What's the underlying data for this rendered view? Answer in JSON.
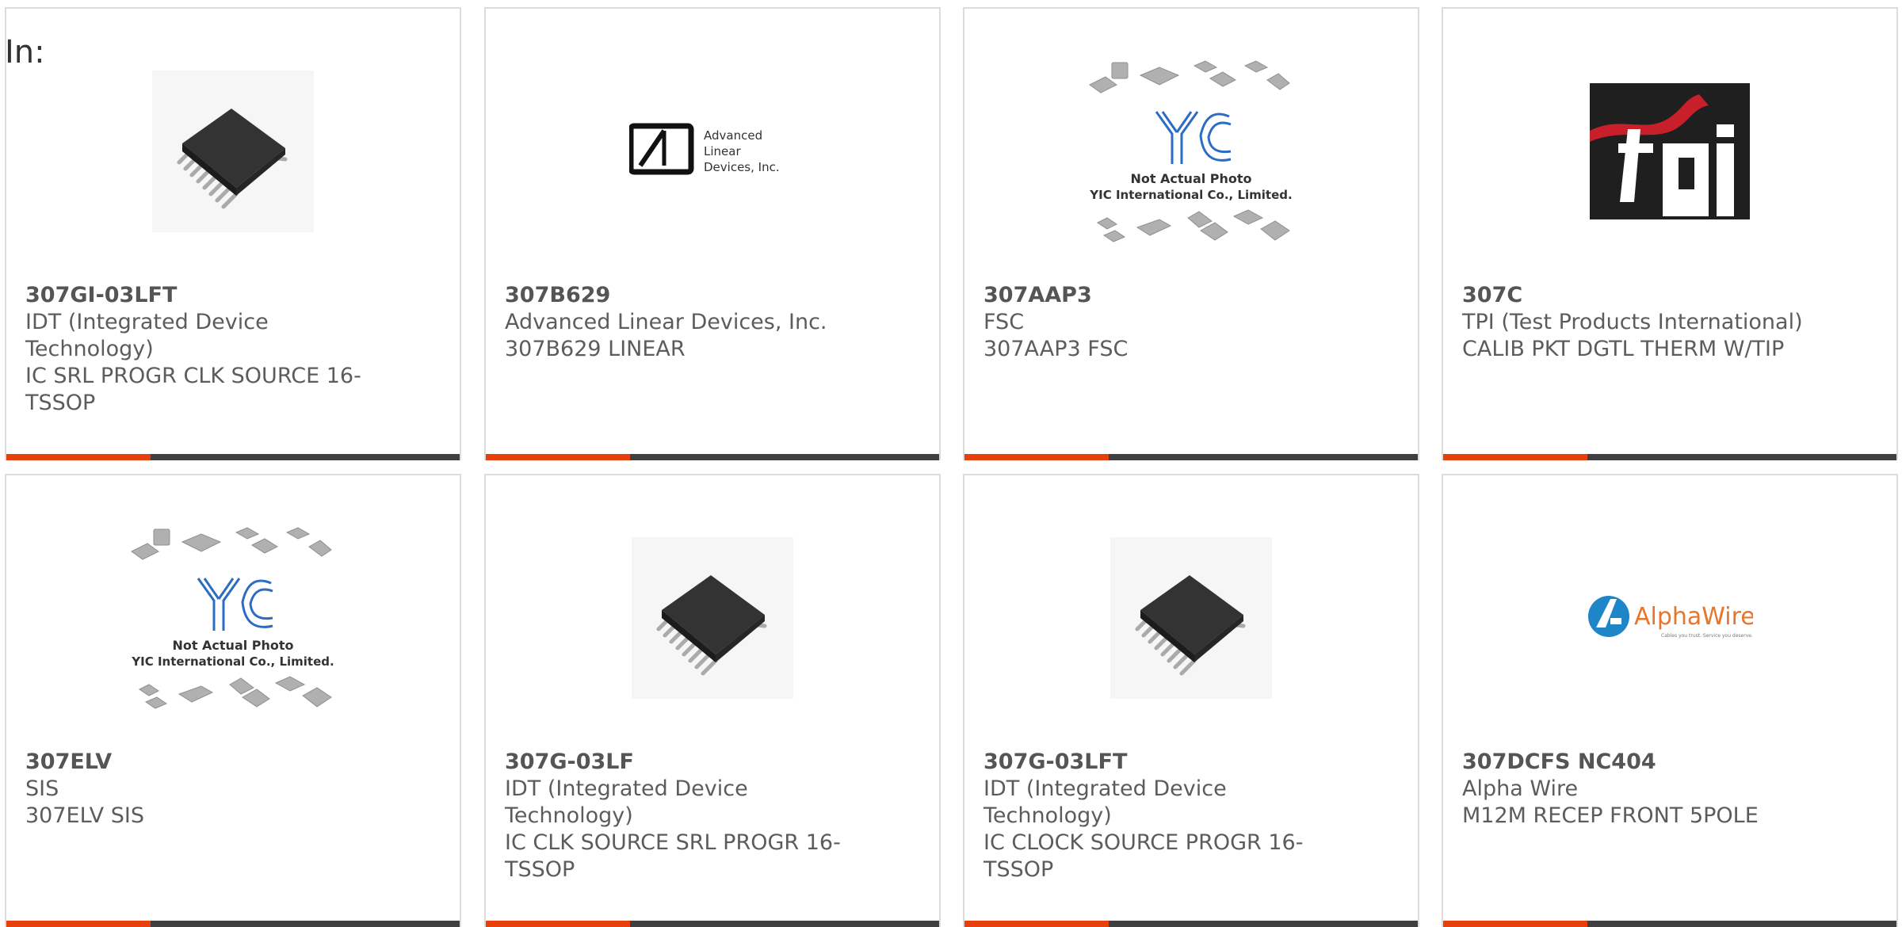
{
  "page": {
    "in_label": "In:"
  },
  "colors": {
    "accent": "#e8400c",
    "bar": "#3f3f3f",
    "border": "#dcdcdc",
    "text": "#5c5c5c"
  },
  "products": [
    {
      "part": "307GI-03LFT",
      "manufacturer": "IDT (Integrated Device Technology)",
      "description": "IC SRL PROGR CLK SOURCE 16-TSSOP",
      "image": "ic-chip-photo"
    },
    {
      "part": "307B629",
      "manufacturer": "Advanced Linear Devices, Inc.",
      "description": "307B629 LINEAR",
      "image": "advanced-linear-devices-logo",
      "logo_text": [
        "Advanced",
        "Linear",
        "Devices, Inc."
      ]
    },
    {
      "part": "307AAP3",
      "manufacturer": "FSC",
      "description": "307AAP3 FSC",
      "image": "yic-not-actual-photo",
      "placeholder_lines": [
        "Not Actual Photo",
        "YIC International Co., Limited."
      ]
    },
    {
      "part": "307C",
      "manufacturer": "TPI (Test Products International)",
      "description": "CALIB PKT DGTL THERM W/TIP",
      "image": "tpi-logo"
    },
    {
      "part": "307ELV",
      "manufacturer": "SIS",
      "description": "307ELV SIS",
      "image": "yic-not-actual-photo",
      "placeholder_lines": [
        "Not Actual Photo",
        "YIC International Co., Limited."
      ]
    },
    {
      "part": "307G-03LF",
      "manufacturer": "IDT (Integrated Device Technology)",
      "description": "IC CLK SOURCE SRL PROGR 16-TSSOP",
      "image": "ic-chip-photo"
    },
    {
      "part": "307G-03LFT",
      "manufacturer": "IDT (Integrated Device Technology)",
      "description": "IC CLOCK SOURCE PROGR 16-TSSOP",
      "image": "ic-chip-photo"
    },
    {
      "part": "307DCFS NC404",
      "manufacturer": "Alpha Wire",
      "description": "M12M RECEP FRONT 5POLE",
      "image": "alphawire-logo",
      "logo_text": "AlphaWire",
      "tagline": "Cables you trust. Service you deserve."
    }
  ]
}
